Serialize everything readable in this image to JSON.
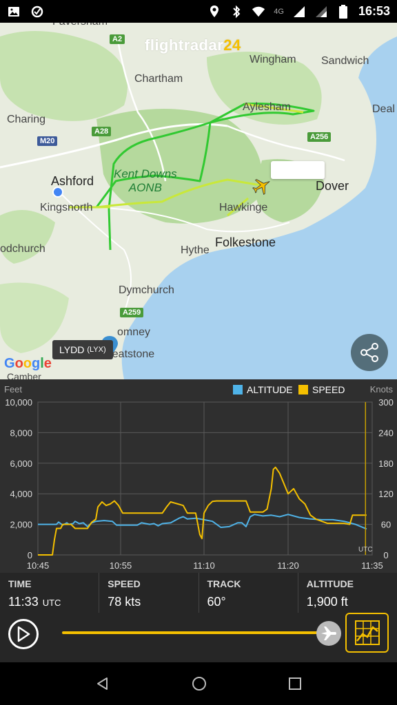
{
  "status_bar": {
    "time": "16:53",
    "network": "4G",
    "icons": [
      "image-icon",
      "sync-icon",
      "location-icon",
      "bluetooth-icon",
      "wifi-icon",
      "signal-icon",
      "signal-icon",
      "battery-icon"
    ]
  },
  "map": {
    "logo_text": "flightradar",
    "logo_num": "24",
    "places": {
      "faversham": "Faversham",
      "wingham": "Wingham",
      "sandwich": "Sandwich",
      "chartham": "Chartham",
      "charing": "Charing",
      "aylesham": "Aylesham",
      "deal": "Deal",
      "ashford": "Ashford",
      "kingsnorth": "Kingsnorth",
      "kent_downs": "Kent Downs",
      "aonb": "AONB",
      "dover": "Dover",
      "hawkinge": "Hawkinge",
      "folkestone": "Folkestone",
      "hythe": "Hythe",
      "newchurch": "odchurch",
      "dymchurch": "Dymchurch",
      "romney": "omney",
      "greatstone": "Greatstone",
      "camber": "Camber"
    },
    "roads": {
      "a2": "A2",
      "a28": "A28",
      "m20": "M20",
      "a256": "A256",
      "a259": "A259"
    },
    "airport": {
      "name": "LYDD",
      "code": "(LYX)"
    },
    "google_letters": [
      "G",
      "o",
      "o",
      "g",
      "l",
      "e"
    ],
    "colors": {
      "sea": "#a8d1ef",
      "land": "#e8ecdf",
      "park": "#b9dca2",
      "track_green": "#31c931",
      "track_yellow": "#c9e83a"
    }
  },
  "chart": {
    "left_unit": "Feet",
    "right_unit": "Knots",
    "legend": [
      {
        "label": "ALTITUDE",
        "color": "#4fb3e8"
      },
      {
        "label": "SPEED",
        "color": "#f5c000"
      }
    ],
    "utc_marker": "UTC",
    "left_ticks": [
      "10,000",
      "8,000",
      "6,000",
      "4,000",
      "2,000",
      "0"
    ],
    "right_ticks": [
      "300",
      "240",
      "180",
      "120",
      "60",
      "0"
    ],
    "x_ticks": [
      "10:45",
      "10:55",
      "11:10",
      "11:20",
      "11:35"
    ]
  },
  "chart_data": {
    "type": "line",
    "x_axis": {
      "label": "",
      "ticks": [
        "10:45",
        "10:55",
        "11:10",
        "11:20",
        "11:35"
      ],
      "grid": true
    },
    "y_left": {
      "label": "Feet",
      "range": [
        0,
        10000
      ]
    },
    "y_right": {
      "label": "Knots",
      "range": [
        0,
        300
      ]
    },
    "legend_position": "top-right",
    "series": [
      {
        "name": "ALTITUDE",
        "axis": "left",
        "color": "#4fb3e8",
        "points": [
          [
            0,
            2000
          ],
          [
            9,
            2000
          ],
          [
            10,
            2150
          ],
          [
            12,
            1950
          ],
          [
            14,
            2100
          ],
          [
            15,
            2000
          ],
          [
            17,
            2050
          ],
          [
            18,
            2200
          ],
          [
            20,
            2050
          ],
          [
            22,
            2100
          ],
          [
            24,
            1850
          ],
          [
            26,
            2100
          ],
          [
            28,
            2200
          ],
          [
            32,
            2250
          ],
          [
            36,
            2200
          ],
          [
            38,
            1950
          ],
          [
            44,
            1950
          ],
          [
            48,
            1950
          ],
          [
            50,
            2100
          ],
          [
            54,
            2000
          ],
          [
            56,
            2050
          ],
          [
            58,
            1900
          ],
          [
            60,
            2050
          ],
          [
            64,
            2100
          ],
          [
            68,
            2400
          ],
          [
            70,
            2500
          ],
          [
            72,
            2350
          ],
          [
            76,
            2400
          ],
          [
            80,
            2300
          ],
          [
            84,
            2200
          ],
          [
            88,
            1800
          ],
          [
            92,
            1850
          ],
          [
            96,
            2100
          ],
          [
            98,
            2100
          ],
          [
            100,
            1850
          ],
          [
            102,
            2500
          ],
          [
            104,
            2650
          ],
          [
            108,
            2550
          ],
          [
            112,
            2600
          ],
          [
            116,
            2500
          ],
          [
            120,
            2650
          ],
          [
            124,
            2450
          ],
          [
            128,
            2350
          ],
          [
            132,
            2300
          ],
          [
            136,
            2300
          ],
          [
            140,
            2200
          ],
          [
            144,
            2000
          ],
          [
            148,
            1700
          ]
        ]
      },
      {
        "name": "SPEED",
        "axis": "right",
        "color": "#f5c000",
        "points": [
          [
            0,
            0
          ],
          [
            7,
            0
          ],
          [
            8,
            30
          ],
          [
            9,
            52
          ],
          [
            11,
            52
          ],
          [
            12,
            60
          ],
          [
            16,
            60
          ],
          [
            18,
            52
          ],
          [
            24,
            52
          ],
          [
            26,
            64
          ],
          [
            28,
            70
          ],
          [
            29,
            94
          ],
          [
            31,
            104
          ],
          [
            33,
            97
          ],
          [
            35,
            100
          ],
          [
            37,
            106
          ],
          [
            39,
            97
          ],
          [
            41,
            82
          ],
          [
            60,
            82
          ],
          [
            62,
            94
          ],
          [
            64,
            104
          ],
          [
            70,
            97
          ],
          [
            72,
            82
          ],
          [
            76,
            82
          ],
          [
            78,
            40
          ],
          [
            79,
            32
          ],
          [
            80,
            82
          ],
          [
            82,
            97
          ],
          [
            84,
            105
          ],
          [
            86,
            106
          ],
          [
            100,
            106
          ],
          [
            102,
            84
          ],
          [
            108,
            84
          ],
          [
            110,
            90
          ],
          [
            112,
            130
          ],
          [
            113,
            168
          ],
          [
            114,
            172
          ],
          [
            116,
            160
          ],
          [
            118,
            140
          ],
          [
            120,
            120
          ],
          [
            122,
            130
          ],
          [
            124,
            110
          ],
          [
            126,
            100
          ],
          [
            128,
            78
          ],
          [
            130,
            70
          ],
          [
            134,
            62
          ],
          [
            140,
            62
          ],
          [
            142,
            60
          ],
          [
            143,
            78
          ],
          [
            148,
            78
          ]
        ]
      }
    ]
  },
  "stats": {
    "time_label": "TIME",
    "time_value": "11:33",
    "time_unit": "UTC",
    "speed_label": "SPEED",
    "speed_value": "78 kts",
    "track_label": "TRACK",
    "track_value": "60°",
    "altitude_label": "ALTITUDE",
    "altitude_value": "1,900 ft"
  },
  "playback": {
    "progress": 0.98
  }
}
